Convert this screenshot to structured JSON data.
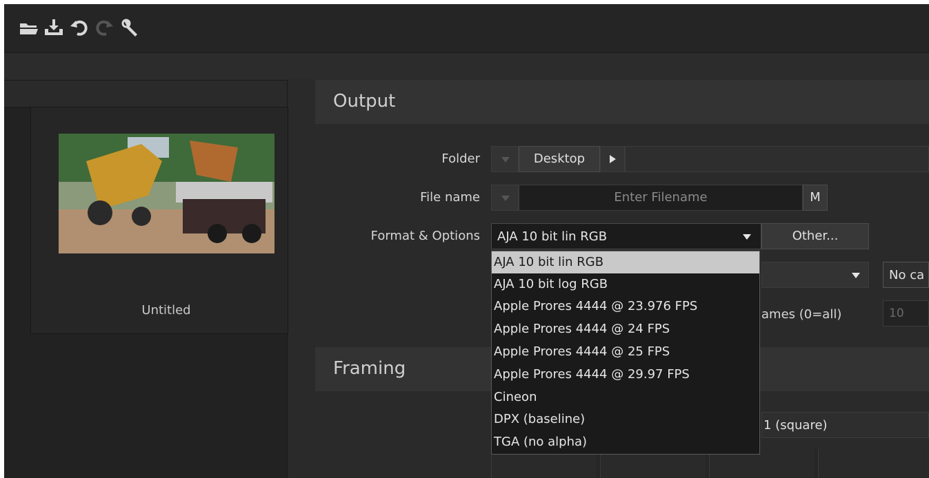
{
  "toolbar": {
    "icons": [
      "open-folder-icon",
      "save-icon",
      "undo-icon",
      "redo-icon",
      "settings-wrench-icon"
    ]
  },
  "preview": {
    "caption": "Untitled"
  },
  "output": {
    "title": "Output",
    "folder": {
      "label": "Folder",
      "value": "Desktop"
    },
    "filename": {
      "label": "File name",
      "placeholder": "Enter Filename",
      "macro_button": "M"
    },
    "format": {
      "label": "Format & Options",
      "value": "AJA 10 bit lin RGB",
      "other_button": "Other..."
    },
    "hidden_row": {
      "right_value": "No ca"
    },
    "frames": {
      "label_partial": "ames (0=all)",
      "value": "10"
    }
  },
  "framing": {
    "title": "Framing",
    "aspect_partial": "1 (square)"
  },
  "format_dropdown": {
    "selected_index": 0,
    "options": [
      "AJA 10 bit lin RGB",
      "AJA 10 bit log RGB",
      "Apple Prores 4444 @ 23.976 FPS",
      "Apple Prores 4444 @ 24 FPS",
      "Apple Prores 4444 @ 25 FPS",
      "Apple Prores 4444 @ 29.97 FPS",
      "Cineon",
      "DPX (baseline)",
      "TGA (no alpha)"
    ]
  },
  "colors": {
    "background": "#2a2a2a",
    "panel_header": "#333333",
    "dropdown_selected": "#c9c9c9"
  }
}
